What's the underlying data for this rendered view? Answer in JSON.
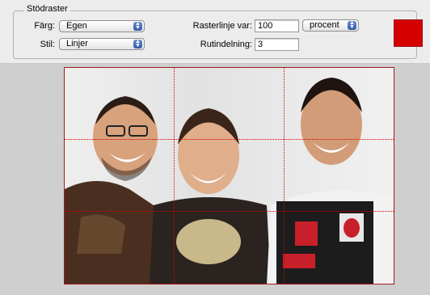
{
  "group": {
    "title": "Stödraster"
  },
  "fields": {
    "color_label": "Färg:",
    "color_value": "Egen",
    "style_label": "Stil:",
    "style_value": "Linjer",
    "gridline_label": "Rasterlinje var:",
    "gridline_value": "100",
    "unit_value": "procent",
    "subdivision_label": "Rutindelning:",
    "subdivision_value": "3"
  },
  "colors": {
    "grid_color": "#d40000",
    "panel_bg": "#ececec",
    "canvas_bg": "#cfcfcf"
  },
  "icons": {
    "select_arrows": "up-down-arrows-icon"
  }
}
